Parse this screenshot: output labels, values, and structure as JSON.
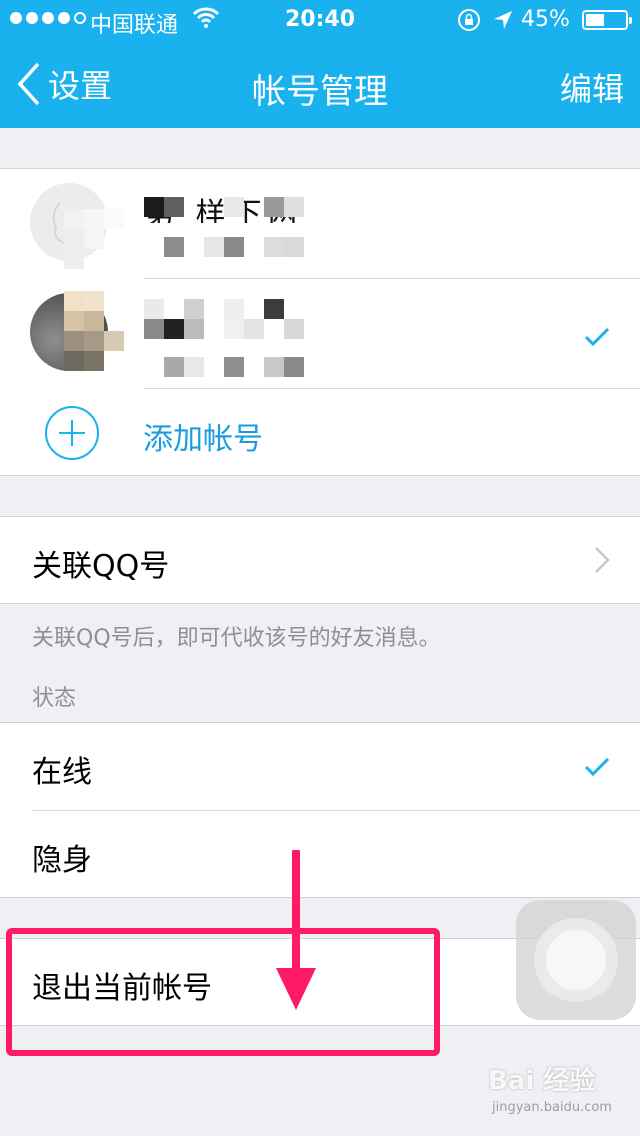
{
  "status_bar": {
    "carrier": "中国联通",
    "time": "20:40",
    "battery": "45%"
  },
  "nav": {
    "back_label": "设置",
    "title": "帐号管理",
    "edit_label": "编辑"
  },
  "accounts": {
    "add_label": "添加帐号",
    "first_name_partial": "第 样下两"
  },
  "link_qq": {
    "label": "关联QQ号",
    "footnote": "关联QQ号后，即可代收该号的好友消息。"
  },
  "status_section": {
    "header": "状态",
    "options": [
      "在线",
      "隐身"
    ]
  },
  "logout": {
    "label": "退出当前帐号"
  },
  "watermark": {
    "brand": "Bai 经验",
    "url": "jingyan.baidu.com"
  },
  "colors": {
    "nav_bar": "#1ab1ef",
    "accent": "#1a9de0",
    "highlight": "#ff1a66"
  }
}
